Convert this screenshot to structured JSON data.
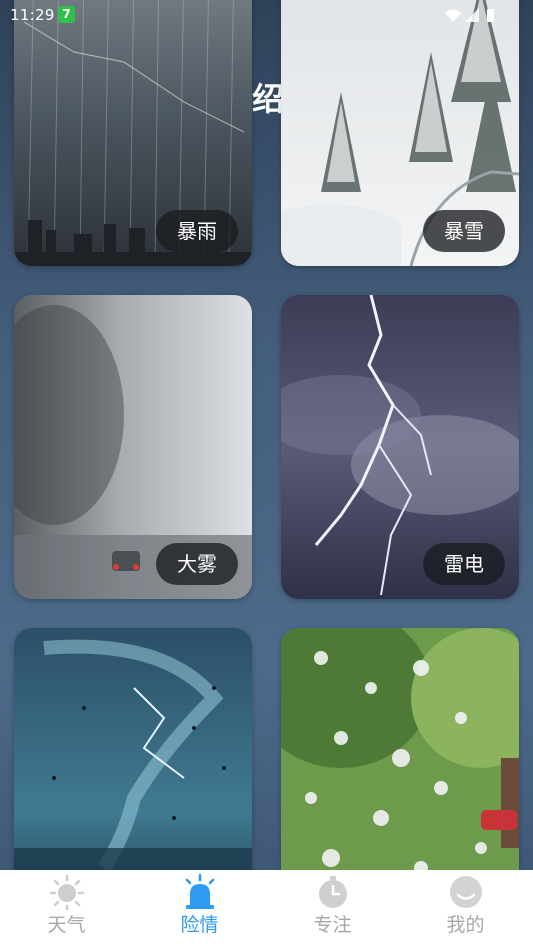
{
  "status_bar": {
    "time": "11:29",
    "badge": "7",
    "icons": [
      "wifi-icon",
      "signal-icon",
      "battery-icon"
    ]
  },
  "page": {
    "title_fragment": "绍"
  },
  "cards": [
    {
      "label": "暴雨",
      "scene": "rainstorm"
    },
    {
      "label": "暴雪",
      "scene": "blizzard"
    },
    {
      "label": "大雾",
      "scene": "heavy-fog"
    },
    {
      "label": "雷电",
      "scene": "thunder-lightning"
    },
    {
      "label": "",
      "scene": "typhoon"
    },
    {
      "label": "",
      "scene": "hail"
    }
  ],
  "bottom_nav": {
    "items": [
      {
        "label": "天气",
        "icon": "sun-icon",
        "active": false
      },
      {
        "label": "险情",
        "icon": "alarm-siren-icon",
        "active": true
      },
      {
        "label": "专注",
        "icon": "stopwatch-icon",
        "active": false
      },
      {
        "label": "我的",
        "icon": "smiley-face-icon",
        "active": false
      }
    ]
  },
  "colors": {
    "active_tab": "#2e9bf0",
    "inactive_tab": "#a7a7a7",
    "label_pill": "#191c20",
    "background": "#45607e"
  }
}
